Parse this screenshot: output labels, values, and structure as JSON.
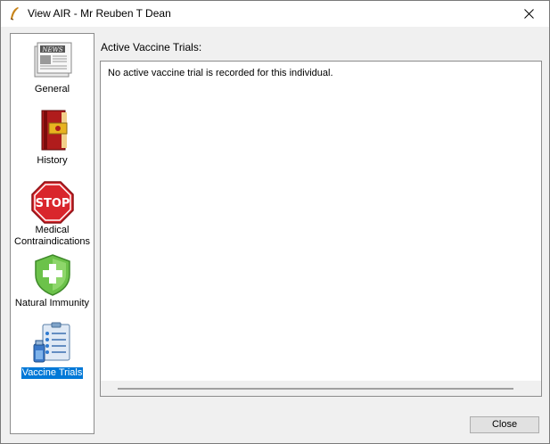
{
  "window": {
    "title": "View AIR - Mr Reuben T Dean"
  },
  "nav": {
    "items": [
      {
        "label": "General",
        "icon": "news-icon"
      },
      {
        "label": "History",
        "icon": "history-book-icon"
      },
      {
        "label": "Medical\nContraindications",
        "icon": "stop-sign-icon"
      },
      {
        "label": "Natural Immunity",
        "icon": "shield-plus-icon"
      },
      {
        "label": "Vaccine Trials",
        "icon": "clipboard-vial-icon",
        "active": true
      }
    ]
  },
  "main": {
    "section_label": "Active Vaccine Trials:",
    "trial_message": "No active vaccine trial is recorded for this individual."
  },
  "footer": {
    "close_label": "Close"
  },
  "colors": {
    "selection": "#0078d7",
    "stop_red": "#d9262c",
    "shield_green": "#6cc24a"
  }
}
